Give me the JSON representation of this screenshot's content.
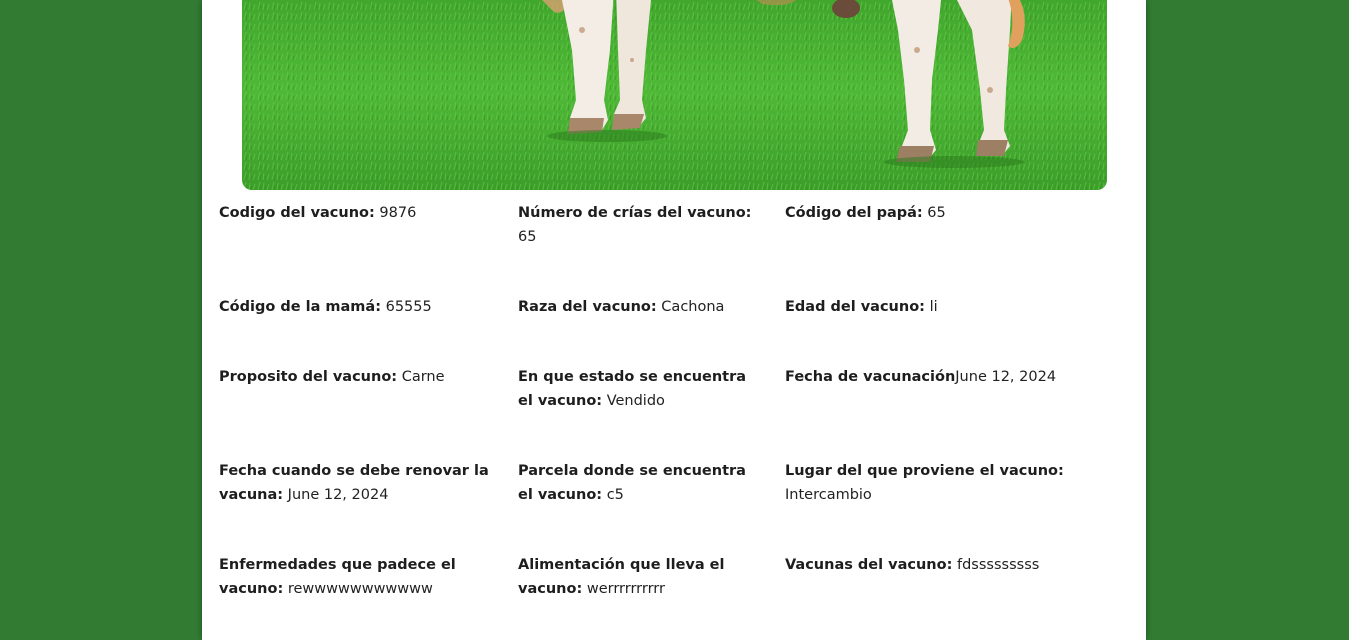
{
  "photo": {
    "description_icon": "cow-photo"
  },
  "fields": {
    "codigo_vacuno": {
      "label": "Codigo del vacuno:",
      "value": " 9876"
    },
    "numero_crias": {
      "label": "Número de crías del vacuno:",
      "value": " 65"
    },
    "codigo_papa": {
      "label": "Código del papá:",
      "value": " 65"
    },
    "codigo_mama": {
      "label": "Código de la mamá:",
      "value": " 65555"
    },
    "raza": {
      "label": "Raza del vacuno:",
      "value": " Cachona"
    },
    "edad": {
      "label": "Edad del vacuno:",
      "value": " li"
    },
    "proposito": {
      "label": "Proposito del vacuno:",
      "value": " Carne"
    },
    "estado": {
      "label": "En que estado se encuentra el vacuno:",
      "value": " Vendido"
    },
    "fecha_vacunacion": {
      "label": "Fecha de vacunación",
      "value": "June 12, 2024"
    },
    "fecha_renovar": {
      "label": "Fecha cuando se debe renovar la vacuna:",
      "value": " June 12, 2024"
    },
    "parcela": {
      "label": "Parcela donde se encuentra el vacuno:",
      "value": " c5"
    },
    "lugar_proviene": {
      "label": "Lugar del que proviene el vacuno:",
      "value": " Intercambio"
    },
    "enfermedades": {
      "label": "Enfermedades que padece el vacuno:",
      "value": " rewwwwwwwwwww"
    },
    "alimentacion": {
      "label": "Alimentación que lleva el vacuno:",
      "value": " werrrrrrrrrr"
    },
    "vacunas": {
      "label": "Vacunas del vacuno:",
      "value": " fdsssssssss"
    }
  }
}
